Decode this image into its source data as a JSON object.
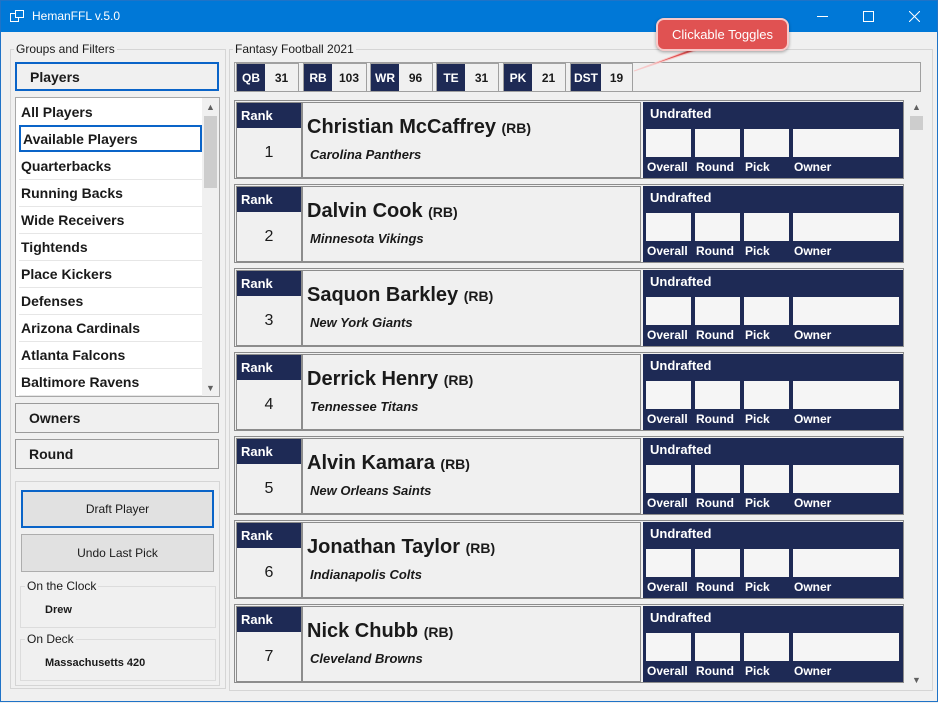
{
  "window": {
    "title": "HemanFFL v.5.0"
  },
  "left_panel": {
    "group_title": "Groups and Filters",
    "players_label": "Players",
    "list_items": [
      "All Players",
      "Available Players",
      "Quarterbacks",
      "Running Backs",
      "Wide Receivers",
      "Tightends",
      "Place Kickers",
      "Defenses",
      "Arizona Cardinals",
      "Atlanta Falcons",
      "Baltimore Ravens"
    ],
    "selected_item": "Available Players",
    "owners_label": "Owners",
    "round_label": "Round",
    "draft_button": "Draft Player",
    "undo_button": "Undo Last Pick",
    "on_the_clock_title": "On the Clock",
    "on_the_clock_value": "Drew",
    "on_deck_title": "On Deck",
    "on_deck_value": "Massachusetts 420"
  },
  "main": {
    "group_title": "Fantasy Football 2021",
    "toggles": [
      {
        "pos": "QB",
        "count": "31"
      },
      {
        "pos": "RB",
        "count": "103"
      },
      {
        "pos": "WR",
        "count": "96"
      },
      {
        "pos": "TE",
        "count": "31"
      },
      {
        "pos": "PK",
        "count": "21"
      },
      {
        "pos": "DST",
        "count": "19"
      }
    ],
    "callout": "Clickable Toggles",
    "card_labels": {
      "rank": "Rank",
      "overall": "Overall",
      "round": "Round",
      "pick": "Pick",
      "owner": "Owner"
    },
    "players": [
      {
        "rank": "1",
        "name": "Christian McCaffrey",
        "position": "(RB)",
        "team": "Carolina Panthers",
        "status": "Undrafted"
      },
      {
        "rank": "2",
        "name": "Dalvin Cook",
        "position": "(RB)",
        "team": "Minnesota Vikings",
        "status": "Undrafted"
      },
      {
        "rank": "3",
        "name": "Saquon Barkley",
        "position": "(RB)",
        "team": "New York Giants",
        "status": "Undrafted"
      },
      {
        "rank": "4",
        "name": "Derrick Henry",
        "position": "(RB)",
        "team": "Tennessee Titans",
        "status": "Undrafted"
      },
      {
        "rank": "5",
        "name": "Alvin Kamara",
        "position": "(RB)",
        "team": "New Orleans Saints",
        "status": "Undrafted"
      },
      {
        "rank": "6",
        "name": "Jonathan Taylor",
        "position": "(RB)",
        "team": "Indianapolis Colts",
        "status": "Undrafted"
      },
      {
        "rank": "7",
        "name": "Nick Chubb",
        "position": "(RB)",
        "team": "Cleveland Browns",
        "status": "Undrafted"
      }
    ]
  },
  "colors": {
    "navy": "#1e2a55",
    "titlebar": "#0078d7",
    "callout": "#e05252",
    "focus": "#0a64c8"
  }
}
